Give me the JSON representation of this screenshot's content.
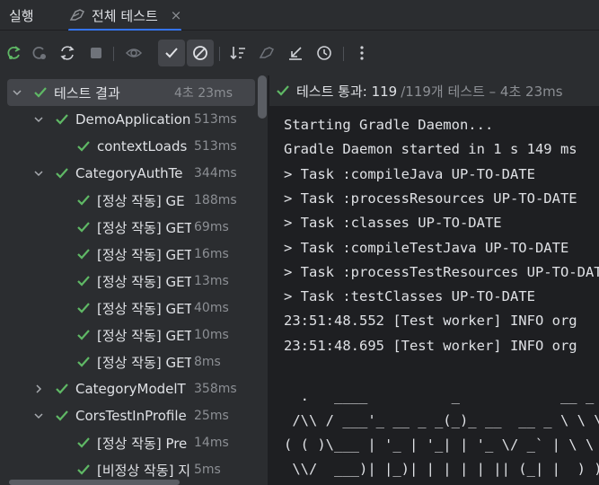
{
  "tabs": {
    "run": "실행",
    "all_tests": "전체 테스트",
    "close": "×"
  },
  "toolbar": {
    "buttons": [
      "rerun-icon",
      "rerun-failed-icon",
      "toggle-auto-test-icon",
      "stop-icon",
      "show-ignored-icon",
      "show-passed-icon",
      "show-ignored-filter-icon",
      "sort-icon",
      "import-tests-icon",
      "export-icon",
      "history-icon",
      "more-icon"
    ]
  },
  "tree": {
    "rows": [
      {
        "label": "테스트 결과",
        "time": "4초 23ms"
      },
      {
        "label": "DemoApplication",
        "time": "513ms"
      },
      {
        "label": "contextLoads",
        "time": "513ms"
      },
      {
        "label": "CategoryAuthTe",
        "time": "344ms"
      },
      {
        "label": "[정상 작동] GE",
        "time": "188ms"
      },
      {
        "label": "[정상 작동] GET",
        "time": "69ms"
      },
      {
        "label": "[정상 작동] GET",
        "time": "16ms"
      },
      {
        "label": "[정상 작동] GET",
        "time": "13ms"
      },
      {
        "label": "[정상 작동] GET",
        "time": "40ms"
      },
      {
        "label": "[정상 작동] GET",
        "time": "10ms"
      },
      {
        "label": "[정상 작동] GET",
        "time": "8ms"
      },
      {
        "label": "CategoryModelT",
        "time": "358ms"
      },
      {
        "label": "CorsTestInProfile",
        "time": "25ms"
      },
      {
        "label": "[정상 작동] Pre",
        "time": "14ms"
      },
      {
        "label": "[비정상 작동] 지",
        "time": "5ms"
      }
    ]
  },
  "summary": {
    "passed": "테스트 통과: 119",
    "rest": "/119개 테스트 – 4초 23ms"
  },
  "console": {
    "lines": [
      "Starting Gradle Daemon...",
      "Gradle Daemon started in 1 s 149 ms",
      "> Task :compileJava UP-TO-DATE",
      "> Task :processResources UP-TO-DATE",
      "> Task :classes UP-TO-DATE",
      "> Task :compileTestJava UP-TO-DATE",
      "> Task :processTestResources UP-TO-DATE",
      "> Task :testClasses UP-TO-DATE",
      "23:51:48.552 [Test worker] INFO org",
      "23:51:48.695 [Test worker] INFO org"
    ],
    "banner": [
      "  .   ____          _            __ _ _",
      " /\\\\ / ___'_ __ _ _(_)_ __  __ _ \\ \\ \\ \\",
      "( ( )\\___ | '_ | '_| | '_ \\/ _` | \\ \\ \\ \\",
      " \\\\/  ___)| |_)| | | | | || (_| |  ) ) ) )"
    ]
  },
  "colors": {
    "accent": "#3574f0",
    "pass": "#5fb865",
    "bg": "#1e1f22",
    "panel": "#2b2d30"
  }
}
